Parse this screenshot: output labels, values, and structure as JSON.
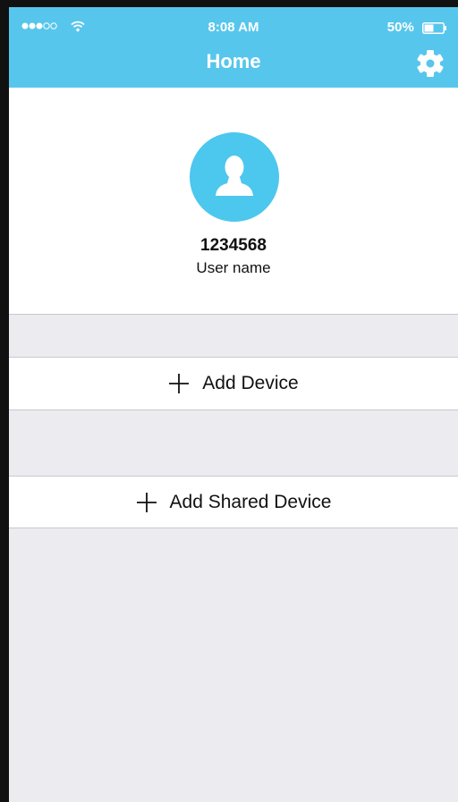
{
  "status_bar": {
    "time": "8:08 AM",
    "battery_percent": "50%",
    "battery_level": 0.5,
    "signal_bars_filled": 3,
    "signal_bars_total": 5
  },
  "header": {
    "title": "Home",
    "settings_icon": "gear-icon",
    "background_color": "#57c6ec"
  },
  "profile": {
    "avatar_icon": "user-silhouette-icon",
    "user_id": "1234568",
    "user_name": "User name"
  },
  "actions": {
    "add_device": {
      "label": "Add Device",
      "icon": "plus-icon"
    },
    "add_shared_device": {
      "label": "Add Shared Device",
      "icon": "plus-icon"
    }
  },
  "colors": {
    "accent": "#57c6ec",
    "background": "#ebebf0",
    "card": "#ffffff",
    "text": "#111111"
  }
}
